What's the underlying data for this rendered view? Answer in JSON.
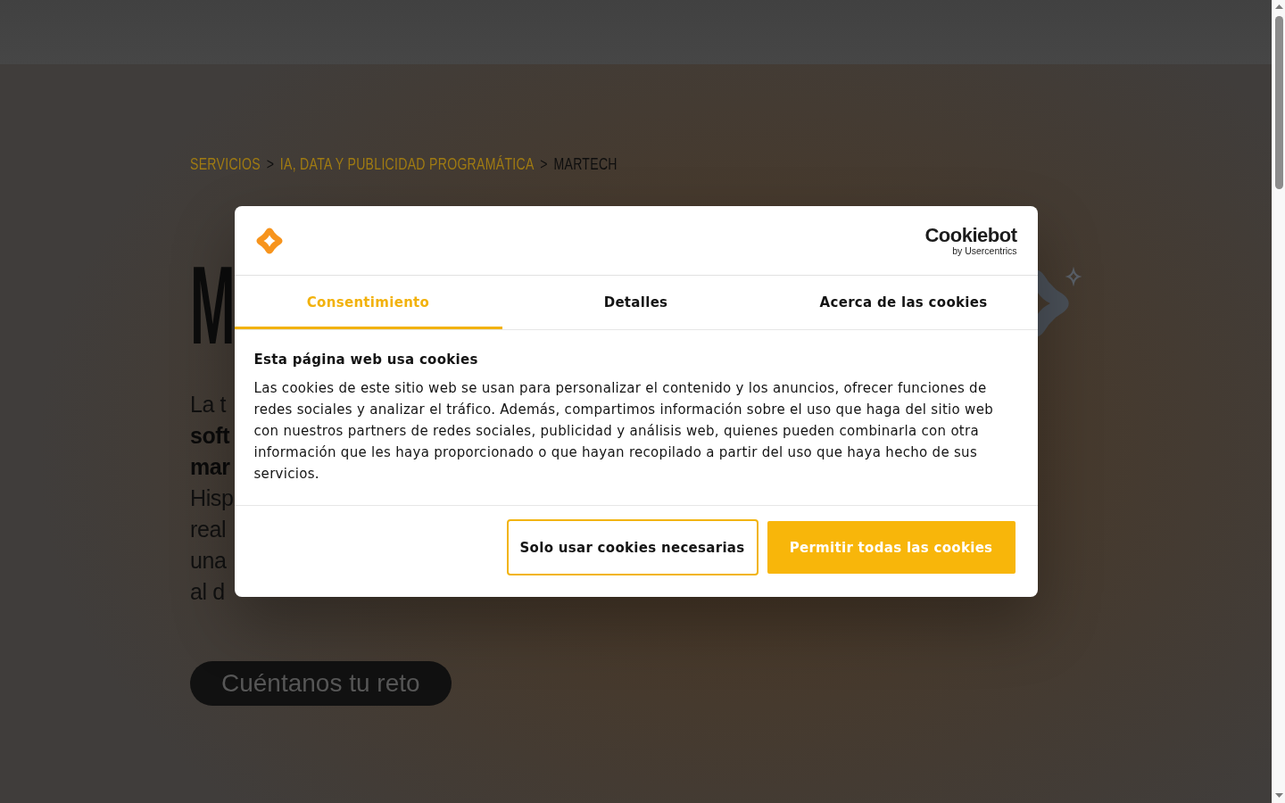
{
  "breadcrumb": [
    {
      "label": "SERVICIOS",
      "kind": "link"
    },
    {
      "label": ">",
      "kind": "separator"
    },
    {
      "label": "IA, DATA Y PUBLICIDAD PROGRAMÁTICA",
      "kind": "link"
    },
    {
      "label": ">",
      "kind": "separator"
    },
    {
      "label": "MARTECH",
      "kind": "current"
    }
  ],
  "hero": {
    "title": "M",
    "intro_lines": [
      {
        "text": "La t",
        "bold": false
      },
      {
        "text": "soft",
        "bold": true
      },
      {
        "text": "mar",
        "bold": true
      },
      {
        "text": "Hisp",
        "bold": false
      },
      {
        "text": "real",
        "bold": false
      },
      {
        "text": "una",
        "bold": false
      },
      {
        "text": "al d",
        "bold": false
      }
    ],
    "cta": "Cuéntanos tu reto"
  },
  "cookie_dialog": {
    "brand": {
      "name": "Cookiebot",
      "byline": "by Usercentrics"
    },
    "tabs": [
      {
        "label": "Consentimiento",
        "selected": true
      },
      {
        "label": "Detalles",
        "selected": false
      },
      {
        "label": "Acerca de las cookies",
        "selected": false
      }
    ],
    "title": "Esta página web usa cookies",
    "text": "Las cookies de este sitio web se usan para personalizar el contenido y los anuncios, ofrecer funciones de redes sociales y analizar el tráfico. Además, compartimos información sobre el uso que haga del sitio web con nuestros partners de redes sociales, publicidad y análisis web, quienes pueden combinarla con otra información que les haya proporcionado o que hayan recopilado a partir del uso que haya hecho de sus servicios.",
    "buttons": [
      {
        "label": "Solo usar cookies necesarias",
        "kind": "outline"
      },
      {
        "label": "Permitir todas las cookies",
        "kind": "primary"
      }
    ]
  }
}
